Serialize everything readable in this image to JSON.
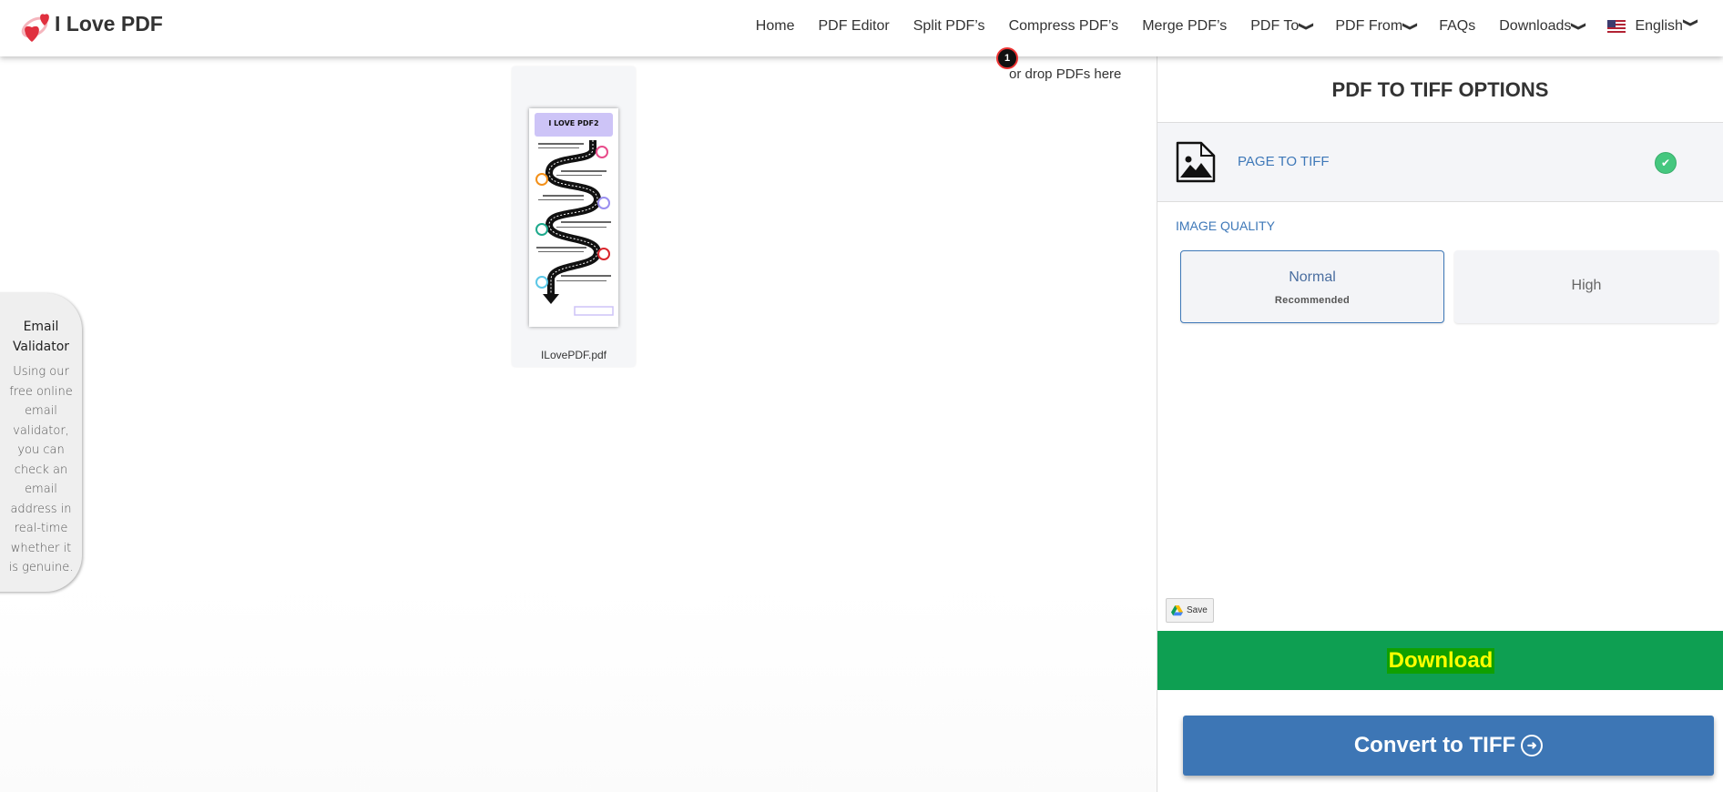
{
  "header": {
    "logo_text": "I Love PDF",
    "nav": [
      {
        "label": "Home"
      },
      {
        "label": "PDF Editor"
      },
      {
        "label": "Split PDF’s"
      },
      {
        "label": "Compress PDF’s"
      },
      {
        "label": "Merge PDF’s"
      },
      {
        "label": "PDF To",
        "dropdown": true
      },
      {
        "label": "PDF From",
        "dropdown": true
      },
      {
        "label": "FAQs"
      },
      {
        "label": "Downloads",
        "dropdown": true
      }
    ],
    "language": "English"
  },
  "upload": {
    "file_count": "1",
    "drop_text": "or drop PDFs here",
    "files": [
      {
        "name": "ILovePDF.pdf",
        "preview_title": "I LOVE PDF2"
      }
    ]
  },
  "sidebar_ad": {
    "title": "Email Validator",
    "text": "Using our free online email validator, you can check an email address in real-time whether it is genuine."
  },
  "panel": {
    "title": "PDF TO TIFF OPTIONS",
    "mode": {
      "label": "PAGE TO TIFF",
      "selected": true,
      "icon": "image-file-icon"
    },
    "quality_label": "IMAGE QUALITY",
    "quality_options": [
      {
        "label": "Normal",
        "sub": "Recommended",
        "selected": true
      },
      {
        "label": "High",
        "selected": false
      }
    ],
    "save_label": "Save",
    "download_label": "Download",
    "convert_label": "Convert to TIFF"
  },
  "colors": {
    "accent": "#3d76b5",
    "download": "#0e9f52",
    "check": "#45c77f"
  }
}
